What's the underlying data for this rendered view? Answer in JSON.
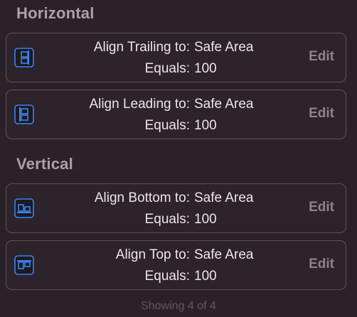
{
  "sections": {
    "horizontal": {
      "title": "Horizontal"
    },
    "vertical": {
      "title": "Vertical"
    }
  },
  "constraints": [
    {
      "icon": "align-trailing-icon",
      "label": "Align Trailing to:",
      "target": "Safe Area",
      "equals_label": "Equals:",
      "equals_value": "100",
      "edit": "Edit"
    },
    {
      "icon": "align-leading-icon",
      "label": "Align Leading to:",
      "target": "Safe Area",
      "equals_label": "Equals:",
      "equals_value": "100",
      "edit": "Edit"
    },
    {
      "icon": "align-bottom-icon",
      "label": "Align Bottom to:",
      "target": "Safe Area",
      "equals_label": "Equals:",
      "equals_value": "100",
      "edit": "Edit"
    },
    {
      "icon": "align-top-icon",
      "label": "Align Top to:",
      "target": "Safe Area",
      "equals_label": "Equals:",
      "equals_value": "100",
      "edit": "Edit"
    }
  ],
  "footer": {
    "text": "Showing 4 of 4"
  },
  "colors": {
    "accent": "#3b82f6",
    "background": "#2b2129",
    "card_border": "#5c535a"
  }
}
